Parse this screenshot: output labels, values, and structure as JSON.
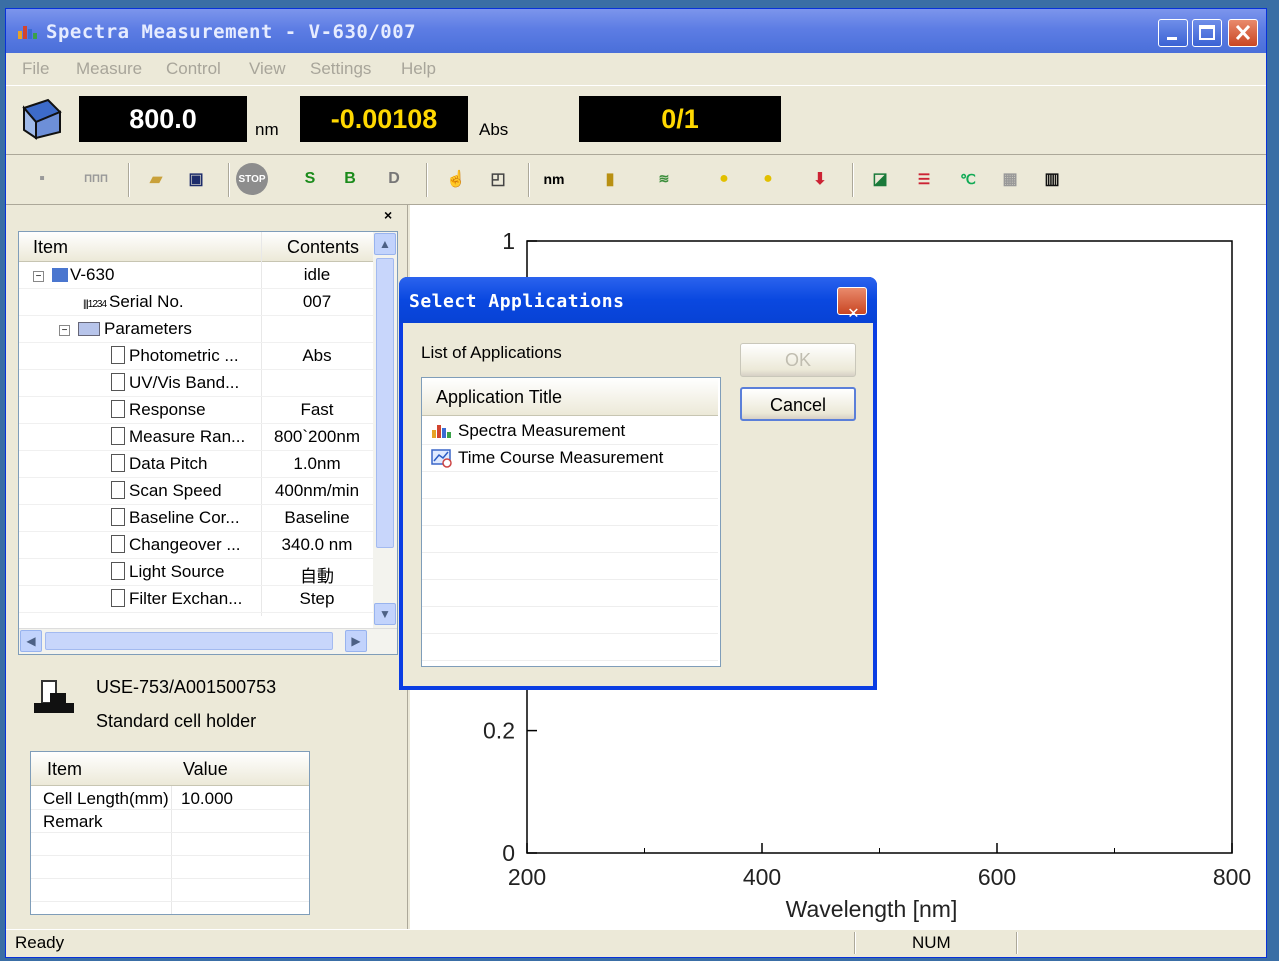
{
  "window": {
    "title": "Spectra Measurement - V-630/007"
  },
  "menu": [
    "File",
    "Measure",
    "Control",
    "View",
    "Settings",
    "Help"
  ],
  "readouts": {
    "wavelength": "800.0",
    "wavelength_unit": "nm",
    "value": "-0.00108",
    "value_unit": "Abs",
    "progress": "0/1"
  },
  "toolbar_icons": [
    "save-icon",
    "ruler-icon",
    "open-folder-icon",
    "save-file-icon",
    "stop-icon",
    "s-icon",
    "b-icon",
    "d-icon",
    "pointer-icon",
    "graph-icon",
    "nm-icon",
    "door-icon",
    "wave-icon",
    "d2-lamp-icon",
    "wi-lamp-icon",
    "download-icon",
    "chart-icon",
    "lines-icon",
    "temp-icon",
    "grid-icon",
    "bars-icon"
  ],
  "tree": {
    "headers": {
      "item": "Item",
      "contents": "Contents"
    },
    "rows": [
      {
        "item": "V-630",
        "contents": "idle"
      },
      {
        "item": "Serial No.",
        "contents": "007"
      },
      {
        "item": "Parameters",
        "contents": ""
      },
      {
        "item": "Photometric ...",
        "contents": "Abs"
      },
      {
        "item": "UV/Vis Band...",
        "contents": ""
      },
      {
        "item": "Response",
        "contents": "Fast"
      },
      {
        "item": "Measure Ran...",
        "contents": "800`200nm"
      },
      {
        "item": "Data Pitch",
        "contents": "1.0nm"
      },
      {
        "item": "Scan Speed",
        "contents": "400nm/min"
      },
      {
        "item": "Baseline Cor...",
        "contents": "Baseline"
      },
      {
        "item": "Changeover ...",
        "contents": "340.0 nm"
      },
      {
        "item": "Light Source",
        "contents": "自動"
      },
      {
        "item": "Filter Exchan...",
        "contents": "Step"
      }
    ]
  },
  "cell": {
    "model": "USE-753/A001500753",
    "holder": "Standard cell holder",
    "headers": {
      "item": "Item",
      "value": "Value"
    },
    "rows": [
      {
        "item": "Cell Length(mm)",
        "value": "10.000"
      },
      {
        "item": "Remark",
        "value": ""
      }
    ]
  },
  "chart_data": {
    "type": "line",
    "xlabel": "Wavelength [nm]",
    "xlim": [
      200,
      800
    ],
    "ylim": [
      0,
      1
    ],
    "x_ticks": [
      "200",
      "400",
      "600",
      "800"
    ],
    "y_ticks": [
      "1",
      "0.2",
      "0"
    ],
    "series": []
  },
  "dialog": {
    "title": "Select Applications",
    "list_label": "List of Applications",
    "column_header": "Application Title",
    "apps": [
      "Spectra Measurement",
      "Time Course Measurement"
    ],
    "ok_label": "OK",
    "cancel_label": "Cancel"
  },
  "status": {
    "text": "Ready",
    "num": "NUM"
  }
}
